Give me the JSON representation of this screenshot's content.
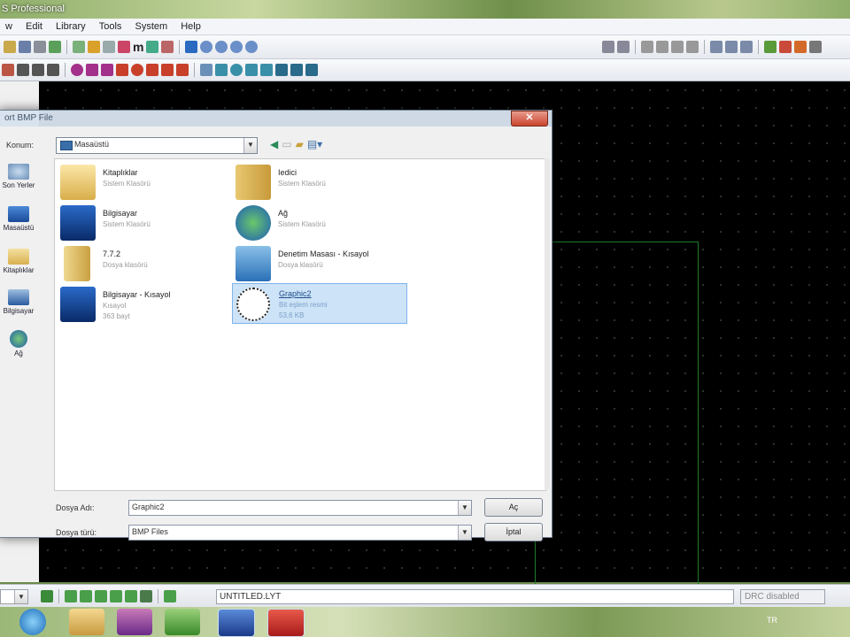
{
  "app": {
    "title": "S Professional",
    "menu": [
      "w",
      "Edit",
      "Library",
      "Tools",
      "System",
      "Help"
    ]
  },
  "status": {
    "file": "UNTITLED.LYT",
    "drc": "DRC disabled"
  },
  "dialog": {
    "title": "ort BMP File",
    "close_glyph": "✕",
    "location_label": "Konum:",
    "location_value": "Masaüstü",
    "places": [
      {
        "label": "Son Yerler"
      },
      {
        "label": "Masaüstü"
      },
      {
        "label": "Kitaplıklar"
      },
      {
        "label": "Bilgisayar"
      },
      {
        "label": "Ağ"
      }
    ],
    "files": [
      {
        "name": "Kitaplıklar",
        "type": "Sistem Klasörü",
        "size": ""
      },
      {
        "name": "Iedici",
        "type": "Sistem Klasörü",
        "size": ""
      },
      {
        "name": "Bilgisayar",
        "type": "Sistem Klasörü",
        "size": ""
      },
      {
        "name": "Ağ",
        "type": "Sistem Klasörü",
        "size": ""
      },
      {
        "name": "7.7.2",
        "type": "Dosya klasörü",
        "size": ""
      },
      {
        "name": "Denetim Masası - Kısayol",
        "type": "Dosya klasörü",
        "size": ""
      },
      {
        "name": "Bilgisayar - Kısayol",
        "type": "Kısayol",
        "size": "363 bayt"
      },
      {
        "name": "Graphic2",
        "type": "Bit eşlem resmi",
        "size": "53,6 KB"
      }
    ],
    "filename_label": "Dosya Adı:",
    "filename_value": "Graphic2",
    "filetype_label": "Dosya türü:",
    "filetype_value": "BMP Files",
    "open_button": "Aç",
    "cancel_button": "İptal"
  },
  "tray": {
    "lang": "TR"
  },
  "colors": {
    "canvas": "#000000",
    "board_outline": "#1f7a2a",
    "selection": "#cde3f7"
  }
}
